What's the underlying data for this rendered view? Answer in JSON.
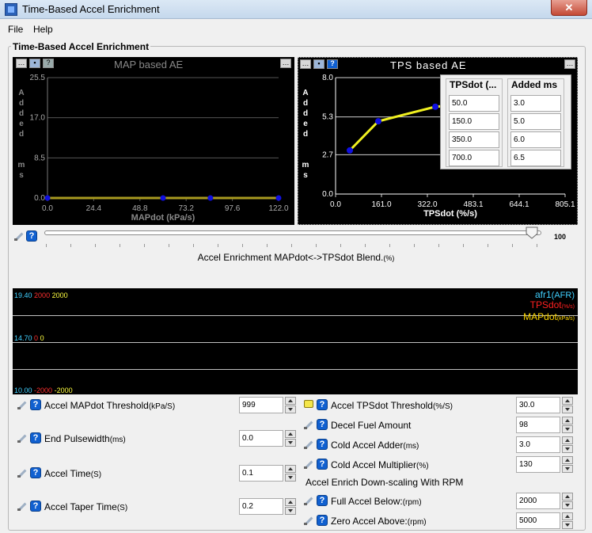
{
  "window": {
    "title": "Time-Based Accel Enrichment"
  },
  "menu": {
    "file": "File",
    "help": "Help"
  },
  "section": {
    "title": "Time-Based Accel Enrichment"
  },
  "charts": {
    "map": {
      "title": "MAP based AE",
      "ylabel_chars": [
        "A",
        "d",
        "d",
        "e",
        "d",
        "",
        "m",
        "s"
      ]
    },
    "tps": {
      "title": "TPS based AE",
      "ylabel_chars": [
        "A",
        "d",
        "d",
        "e",
        "d",
        "",
        "m",
        "s"
      ]
    }
  },
  "chart_data": [
    {
      "type": "line",
      "title": "MAP based AE",
      "xlabel": "MAPdot (kPa/s)",
      "ylabel": "Added ms",
      "x_ticks": [
        "0.0",
        "24.4",
        "48.8",
        "73.2",
        "97.6",
        "122.0"
      ],
      "y_ticks": [
        "25.5",
        "17.0",
        "8.5",
        "0.0"
      ],
      "xlim": [
        0,
        122
      ],
      "ylim": [
        0,
        25.5
      ],
      "x": [
        0,
        61,
        86,
        122
      ],
      "y": [
        0,
        0,
        0,
        0
      ],
      "color": "#a89a20"
    },
    {
      "type": "line",
      "title": "TPS based AE",
      "xlabel": "TPSdot (%/s)",
      "ylabel": "Added ms",
      "x_ticks": [
        "0.0",
        "161.0",
        "322.0",
        "483.1",
        "644.1",
        "805.1"
      ],
      "y_ticks": [
        "8.0",
        "5.3",
        "2.7",
        "0.0"
      ],
      "xlim": [
        0,
        805.1
      ],
      "ylim": [
        0,
        8
      ],
      "x": [
        50,
        150,
        350,
        700
      ],
      "y": [
        3.0,
        5.0,
        6.0,
        6.5
      ],
      "color": "#f0f020"
    }
  ],
  "tps_table": {
    "col1": {
      "header": "TPSdot (...",
      "values": [
        "50.0",
        "150.0",
        "350.0",
        "700.0"
      ]
    },
    "col2": {
      "header": "Added ms",
      "values": [
        "3.0",
        "5.0",
        "6.0",
        "6.5"
      ]
    }
  },
  "slider": {
    "value": "100",
    "label": "Accel Enrichment MAPdot<->TPSdot Blend.",
    "unit": "(%)",
    "fraction": 0.98
  },
  "log": {
    "top": {
      "v1": "19.40",
      "v2": "2000",
      "v3": "2000"
    },
    "mid": {
      "v1": "14.70",
      "v2": "0",
      "v3": "0"
    },
    "bot": {
      "v1": "10.00",
      "v2": "-2000",
      "v3": "-2000"
    },
    "legend": [
      {
        "name": "afr1",
        "unit": "(AFR)",
        "color": "#40d0ff"
      },
      {
        "name": "TPSdot",
        "unit": "(%/s)",
        "color": "#ff2020"
      },
      {
        "name": "MAPdot",
        "unit": "(kPa/s)",
        "color": "#ffd800"
      }
    ],
    "colors": {
      "c1": "#40d0ff",
      "c2": "#ff3030",
      "c3": "#ffff40"
    }
  },
  "left_props": [
    {
      "label": "Accel MAPdot Threshold",
      "unit": "(kPa/S)",
      "value": "999"
    },
    {
      "label": "End Pulsewidth",
      "unit": "(ms)",
      "value": "0.0"
    },
    {
      "label": "Accel Time",
      "unit": "(S)",
      "value": "0.1"
    },
    {
      "label": "Accel Taper Time",
      "unit": "(S)",
      "value": "0.2"
    }
  ],
  "right_props": [
    {
      "label": "Accel TPSdot Threshold",
      "unit": "(%/S)",
      "value": "30.0"
    },
    {
      "label": "Decel Fuel Amount",
      "unit": "",
      "value": "98"
    },
    {
      "label": "Cold Accel Adder",
      "unit": "(ms)",
      "value": "3.0"
    },
    {
      "label": "Cold Accel Multiplier",
      "unit": "(%)",
      "value": "130"
    }
  ],
  "rpm_section": {
    "title": "Accel Enrich Down-scaling With RPM"
  },
  "rpm_props": [
    {
      "label": "Full Accel Below:",
      "unit": "(rpm)",
      "value": "2000"
    },
    {
      "label": "Zero Accel Above:",
      "unit": "(rpm)",
      "value": "5000"
    }
  ]
}
